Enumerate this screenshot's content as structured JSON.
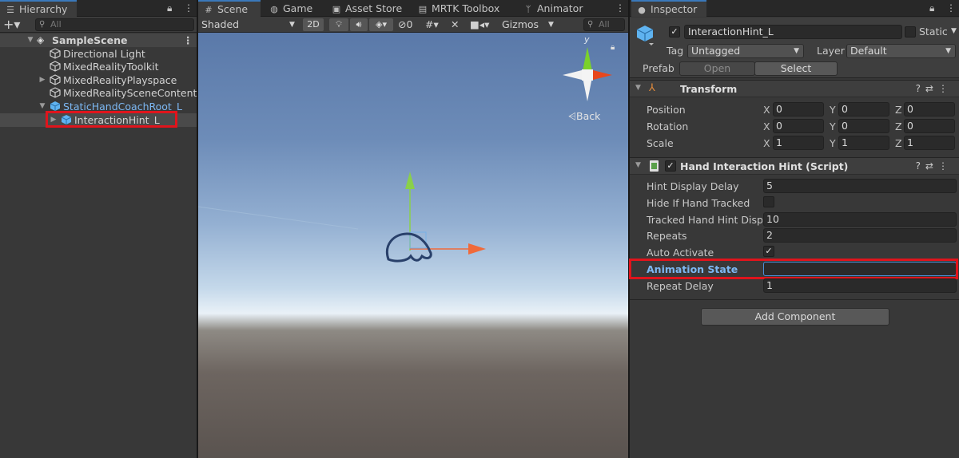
{
  "hierarchy": {
    "tab_label": "Hierarchy",
    "search_placeholder": "All",
    "scene_name": "SampleScene",
    "items": [
      {
        "label": "Directional Light"
      },
      {
        "label": "MixedRealityToolkit"
      },
      {
        "label": "MixedRealityPlayspace"
      },
      {
        "label": "MixedRealitySceneContent"
      },
      {
        "label": "StaticHandCoachRoot_L"
      },
      {
        "label": "InteractionHint_L"
      }
    ]
  },
  "scene_tabs": {
    "scene": "Scene",
    "game": "Game",
    "asset_store": "Asset Store",
    "mrtk_toolbox": "MRTK Toolbox",
    "animator": "Animator"
  },
  "scene_toolbar": {
    "shading_mode": "Shaded",
    "mode_2d": "2D",
    "hidden_count": "0",
    "gizmos": "Gizmos",
    "search_placeholder": "All"
  },
  "viewport": {
    "back_label": "Back",
    "gizmo_axis_y": "y"
  },
  "inspector": {
    "tab_label": "Inspector",
    "object_name": "InteractionHint_L",
    "static_label": "Static",
    "tag_label": "Tag",
    "tag_value": "Untagged",
    "layer_label": "Layer",
    "layer_value": "Default",
    "prefab_label": "Prefab",
    "open_label": "Open",
    "select_label": "Select",
    "transform": {
      "title": "Transform",
      "rows": [
        {
          "label": "Position",
          "x": "0",
          "y": "0",
          "z": "0"
        },
        {
          "label": "Rotation",
          "x": "0",
          "y": "0",
          "z": "0"
        },
        {
          "label": "Scale",
          "x": "1",
          "y": "1",
          "z": "1"
        }
      ],
      "axis_x": "X",
      "axis_y": "Y",
      "axis_z": "Z"
    },
    "script": {
      "title": "Hand Interaction Hint (Script)",
      "hint_display_delay_label": "Hint Display Delay",
      "hint_display_delay": "5",
      "hide_if_tracked_label": "Hide If Hand Tracked",
      "tracked_hint_label": "Tracked Hand Hint Displ",
      "tracked_hint_value": "10",
      "repeats_label": "Repeats",
      "repeats_value": "2",
      "auto_activate_label": "Auto Activate",
      "auto_activate_check": "✓",
      "animation_state_label": "Animation State",
      "animation_state_value": "",
      "repeat_delay_label": "Repeat Delay",
      "repeat_delay_value": "1"
    },
    "add_component_label": "Add Component"
  },
  "colors": {
    "highlight_red": "#e0141c",
    "accent_blue": "#7cb7f2",
    "tab_active_line": "#3a79bb"
  }
}
